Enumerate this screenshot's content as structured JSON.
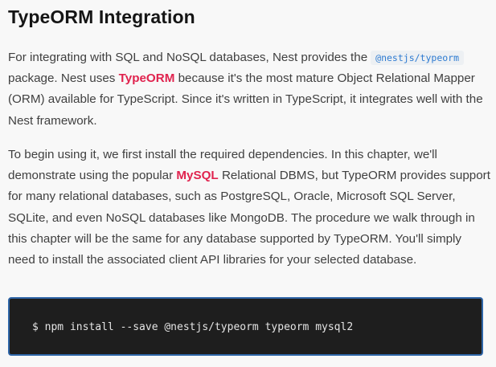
{
  "section": {
    "title": "TypeORM Integration"
  },
  "p1": {
    "t1": "For integrating with SQL and NoSQL databases, Nest provides the",
    "code": "@nestjs/typeorm",
    "t2": " package. Nest uses ",
    "link": "TypeORM",
    "t3": " because it's the most mature Object Relational Mapper (ORM) available for TypeScript. Since it's written in TypeScript, it integrates well with the Nest framework."
  },
  "p2": {
    "t1": "To begin using it, we first install the required dependencies. In this chapter, we'll demonstrate using the popular ",
    "link": "MySQL",
    "t2": " Relational DBMS, but TypeORM provides support for many relational databases, such as PostgreSQL, Oracle, Microsoft SQL Server, SQLite, and even NoSQL databases like MongoDB. The procedure we walk through in this chapter will be the same for any database supported by TypeORM. You'll simply need to install the associated client API libraries for your selected database."
  },
  "code_block": {
    "command": "$ npm install --save @nestjs/typeorm typeorm mysql2"
  },
  "colors": {
    "link": "#e0234e",
    "inline_code": "#2e7bd1",
    "code_bg": "#1e1e1e",
    "code_border": "#2f66a8"
  }
}
